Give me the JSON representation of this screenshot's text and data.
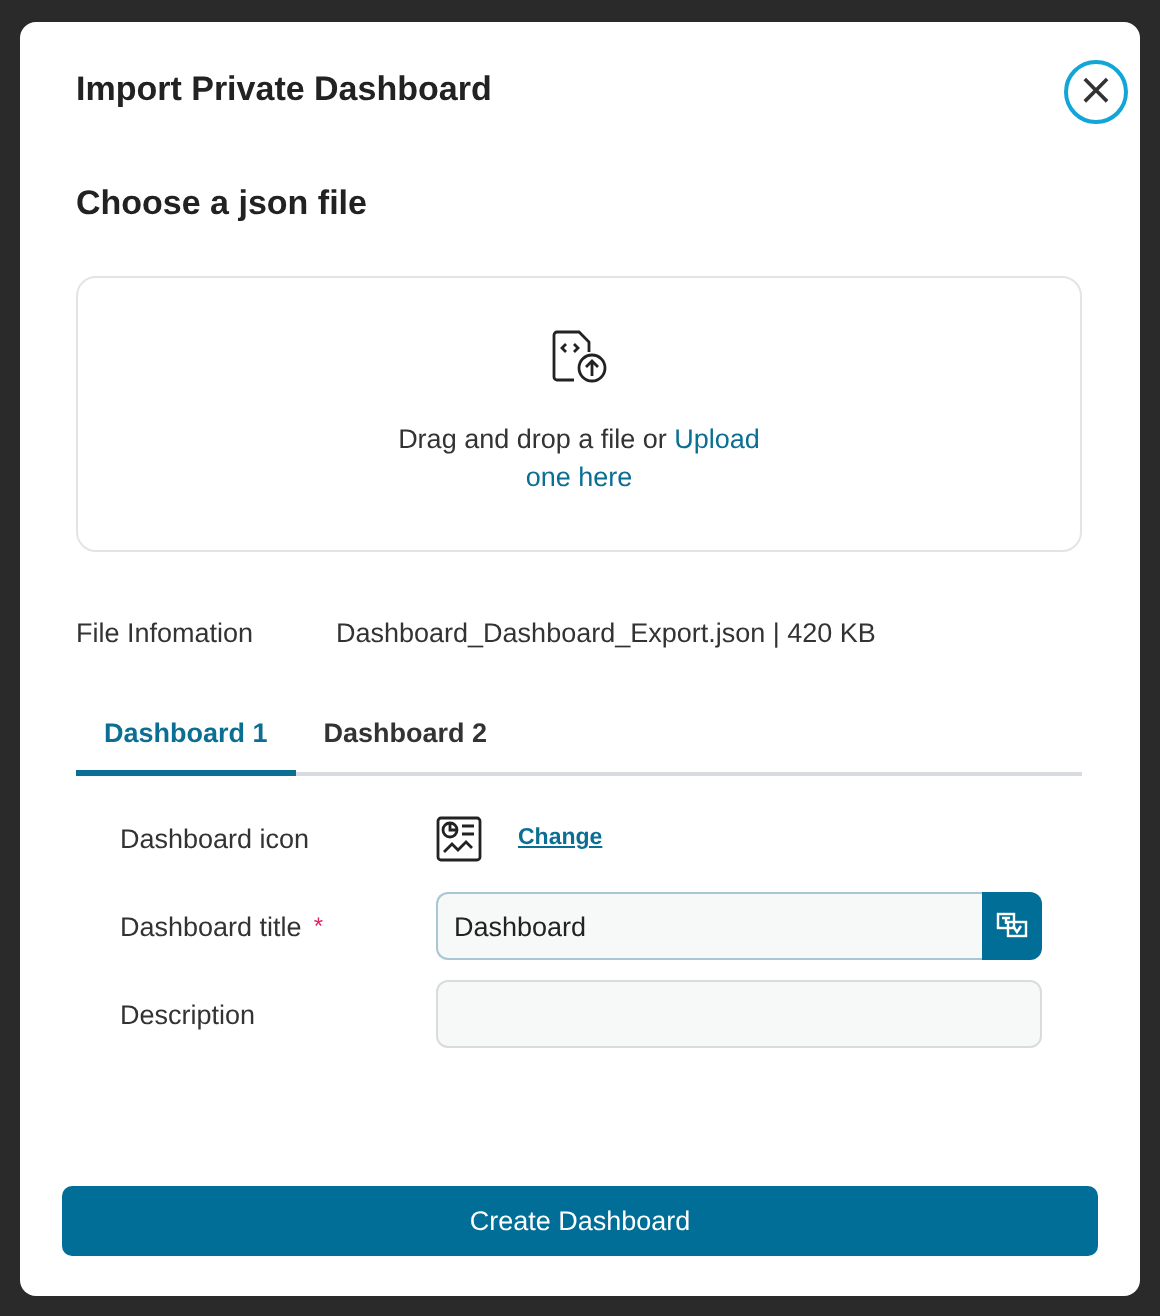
{
  "dialog": {
    "title": "Import Private Dashboard",
    "close_label": "×"
  },
  "upload": {
    "heading": "Choose a json file",
    "prompt": "Drag and drop a file or ",
    "link_lines": [
      "Upload",
      "one here"
    ]
  },
  "file_info": {
    "label": "File Infomation",
    "value": "Dashboard_Dashboard_Export.json | 420 KB"
  },
  "tabs": [
    {
      "label": "Dashboard 1",
      "selected": true
    },
    {
      "label": "Dashboard 2",
      "selected": false
    }
  ],
  "form": {
    "icon_label": "Dashboard icon",
    "change_link": "Change",
    "title_label": "Dashboard title",
    "title_required": true,
    "required_mark": "*",
    "title_value": "Dashboard",
    "description_label": "Description"
  },
  "primary_button": "Create Dashboard"
}
